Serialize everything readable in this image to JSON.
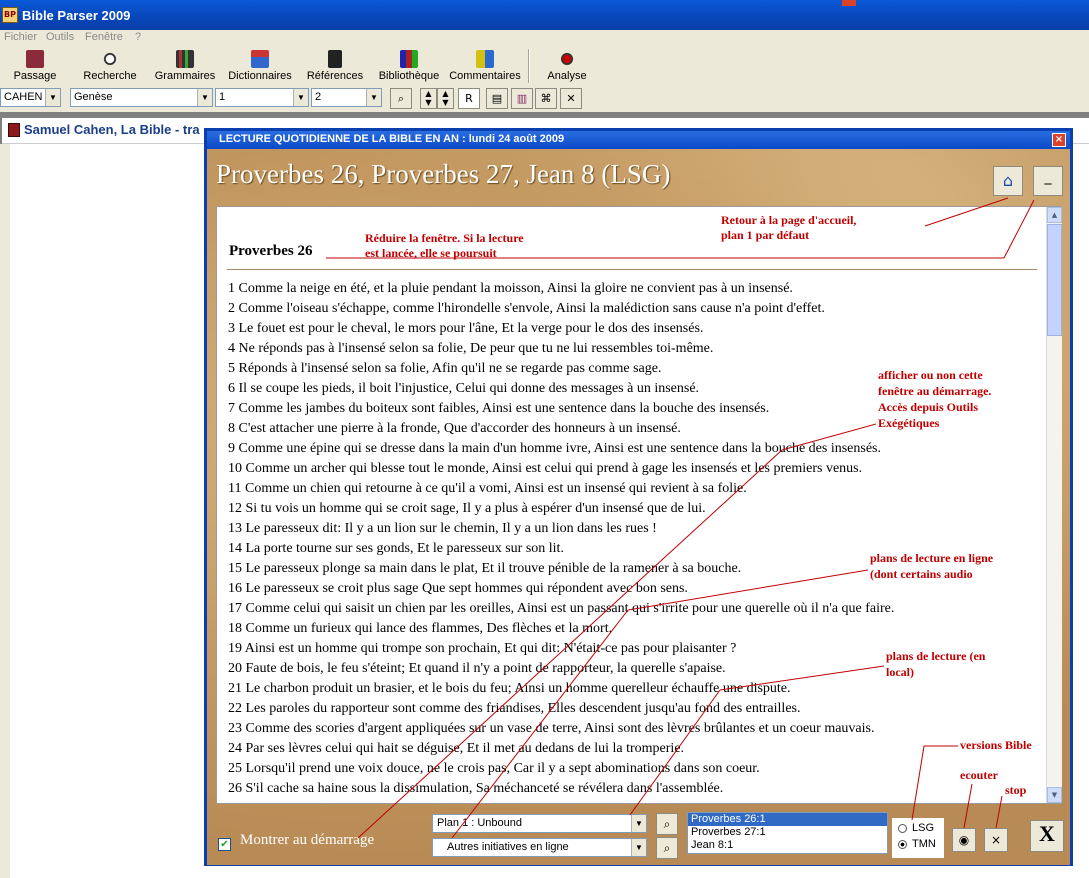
{
  "app": {
    "title": "Bible Parser 2009",
    "logo_text": "BP"
  },
  "menu": [
    "Fichier",
    "Outils",
    "Fenêtre",
    "?"
  ],
  "toolbar": {
    "buttons": [
      {
        "label": "Passage",
        "icon": "book-icon"
      },
      {
        "label": "Recherche",
        "icon": "search-icon"
      },
      {
        "label": "Grammaires",
        "icon": "books-icon"
      },
      {
        "label": "Dictionnaires",
        "icon": "dictionary-icon"
      },
      {
        "label": "Références",
        "icon": "references-icon"
      },
      {
        "label": "Bibliothèque",
        "icon": "library-icon"
      },
      {
        "label": "Commentaires",
        "icon": "commentaries-icon"
      },
      {
        "label": "Analyse",
        "icon": "analysis-icon"
      }
    ]
  },
  "selectors": {
    "version": "CAHEN",
    "book": "Genèse",
    "chapter": "1",
    "verse": "2",
    "r_label": "R"
  },
  "document": {
    "title": "Samuel Cahen, La Bible - tra"
  },
  "dialog": {
    "title": "LECTURE QUOTIDIENNE DE LA BIBLE EN AN : lundi 24 août 2009",
    "close": "×",
    "heading": "Proverbes 26, Proverbes 27, Jean 8 (LSG)",
    "minimize": "_",
    "chapter_title": "Proverbes 26",
    "verses": [
      "1 Comme la neige en été, et la pluie pendant la moisson, Ainsi la gloire ne convient pas à un insensé.",
      "2 Comme l'oiseau s'échappe, comme l'hirondelle s'envole, Ainsi la malédiction sans cause n'a point d'effet.",
      "3 Le fouet est pour le cheval, le mors pour l'âne, Et la verge pour le dos des insensés.",
      "4 Ne réponds pas à l'insensé selon sa folie, De peur que tu ne lui ressembles toi-même.",
      "5 Réponds à l'insensé selon sa folie, Afin qu'il ne se regarde pas comme sage.",
      "6 Il se coupe les pieds, il boit l'injustice, Celui qui donne des messages à un insensé.",
      "7 Comme les jambes du boiteux sont faibles, Ainsi est une sentence dans la bouche des insensés.",
      "8 C'est attacher une pierre à la fronde, Que d'accorder des honneurs à un insensé.",
      "9 Comme une épine qui se dresse dans la main d'un homme ivre, Ainsi est une sentence dans la bouche des insensés.",
      "10 Comme un archer qui blesse tout le monde, Ainsi est celui qui prend à gage les insensés et les premiers venus.",
      "11 Comme un chien qui retourne à ce qu'il a vomi, Ainsi est un insensé qui revient à sa folie.",
      "12 Si tu vois un homme qui se croit sage, Il y a plus à espérer d'un insensé que de lui.",
      "13 Le paresseux dit: Il y a un lion sur le chemin, Il y a un lion dans les rues !",
      "14 La porte tourne sur ses gonds, Et le paresseux sur son lit.",
      "15 Le paresseux plonge sa main dans le plat, Et il trouve pénible de la ramener à sa bouche.",
      "16 Le paresseux se croit plus sage Que sept hommes qui répondent avec bon sens.",
      "17 Comme celui qui saisit un chien par les oreilles, Ainsi est un passant qui s'irrite pour une querelle où il n'a que faire.",
      "18 Comme un furieux qui lance des flammes, Des flèches et la mort,",
      "19 Ainsi est un homme qui trompe son prochain, Et qui dit: N'était-ce pas pour plaisanter ?",
      "20 Faute de bois, le feu s'éteint; Et quand il n'y a point de rapporteur, la querelle s'apaise.",
      "21 Le charbon produit un brasier, et le bois du feu; Ainsi un homme querelleur échauffe une dispute.",
      "22 Les paroles du rapporteur sont comme des friandises, Elles descendent jusqu'au fond des entrailles.",
      "23 Comme des scories d'argent appliquées sur un vase de terre, Ainsi sont des lèvres brûlantes et un coeur mauvais.",
      "24 Par ses lèvres celui qui hait se déguise, Et il met au dedans de lui la tromperie.",
      "25 Lorsqu'il prend une voix douce, ne le crois pas, Car il y a sept abominations dans son coeur.",
      "26 S'il cache sa haine sous la dissimulation, Sa méchanceté se révélera dans l'assemblée."
    ],
    "show_at_startup_label": "Montrer au démarrage",
    "show_at_startup_checked": true,
    "plan_select": "Plan 1 : Unbound",
    "online_select": "Autres initiatives en ligne",
    "readings": [
      "Proverbes 26:1",
      "Proverbes 27:1",
      "Jean 8:1"
    ],
    "versions": [
      "LSG",
      "TMN"
    ],
    "selected_version": "TMN",
    "stop_label": "×",
    "close_label": "X"
  },
  "annotations": {
    "reduce": [
      "Réduire la fenêtre. Si la lecture",
      "est lancée, elle se poursuit"
    ],
    "home": [
      "Retour à la page d'accueil,",
      "plan 1 par défaut"
    ],
    "startup": [
      "afficher ou non cette",
      "fenêtre au démarrage.",
      "Accès depuis Outils",
      "Exégétiques"
    ],
    "online_plans": [
      "plans de lecture en ligne",
      "(dont certains audio"
    ],
    "local_plans": [
      "plans de lecture (en",
      "local)"
    ],
    "versions": "versions Bible",
    "listen": "ecouter",
    "stop": "stop"
  },
  "colors": {
    "title_blue": "#0a49c8",
    "annotation_red": "#c00000",
    "parchment": "#c9a574"
  }
}
